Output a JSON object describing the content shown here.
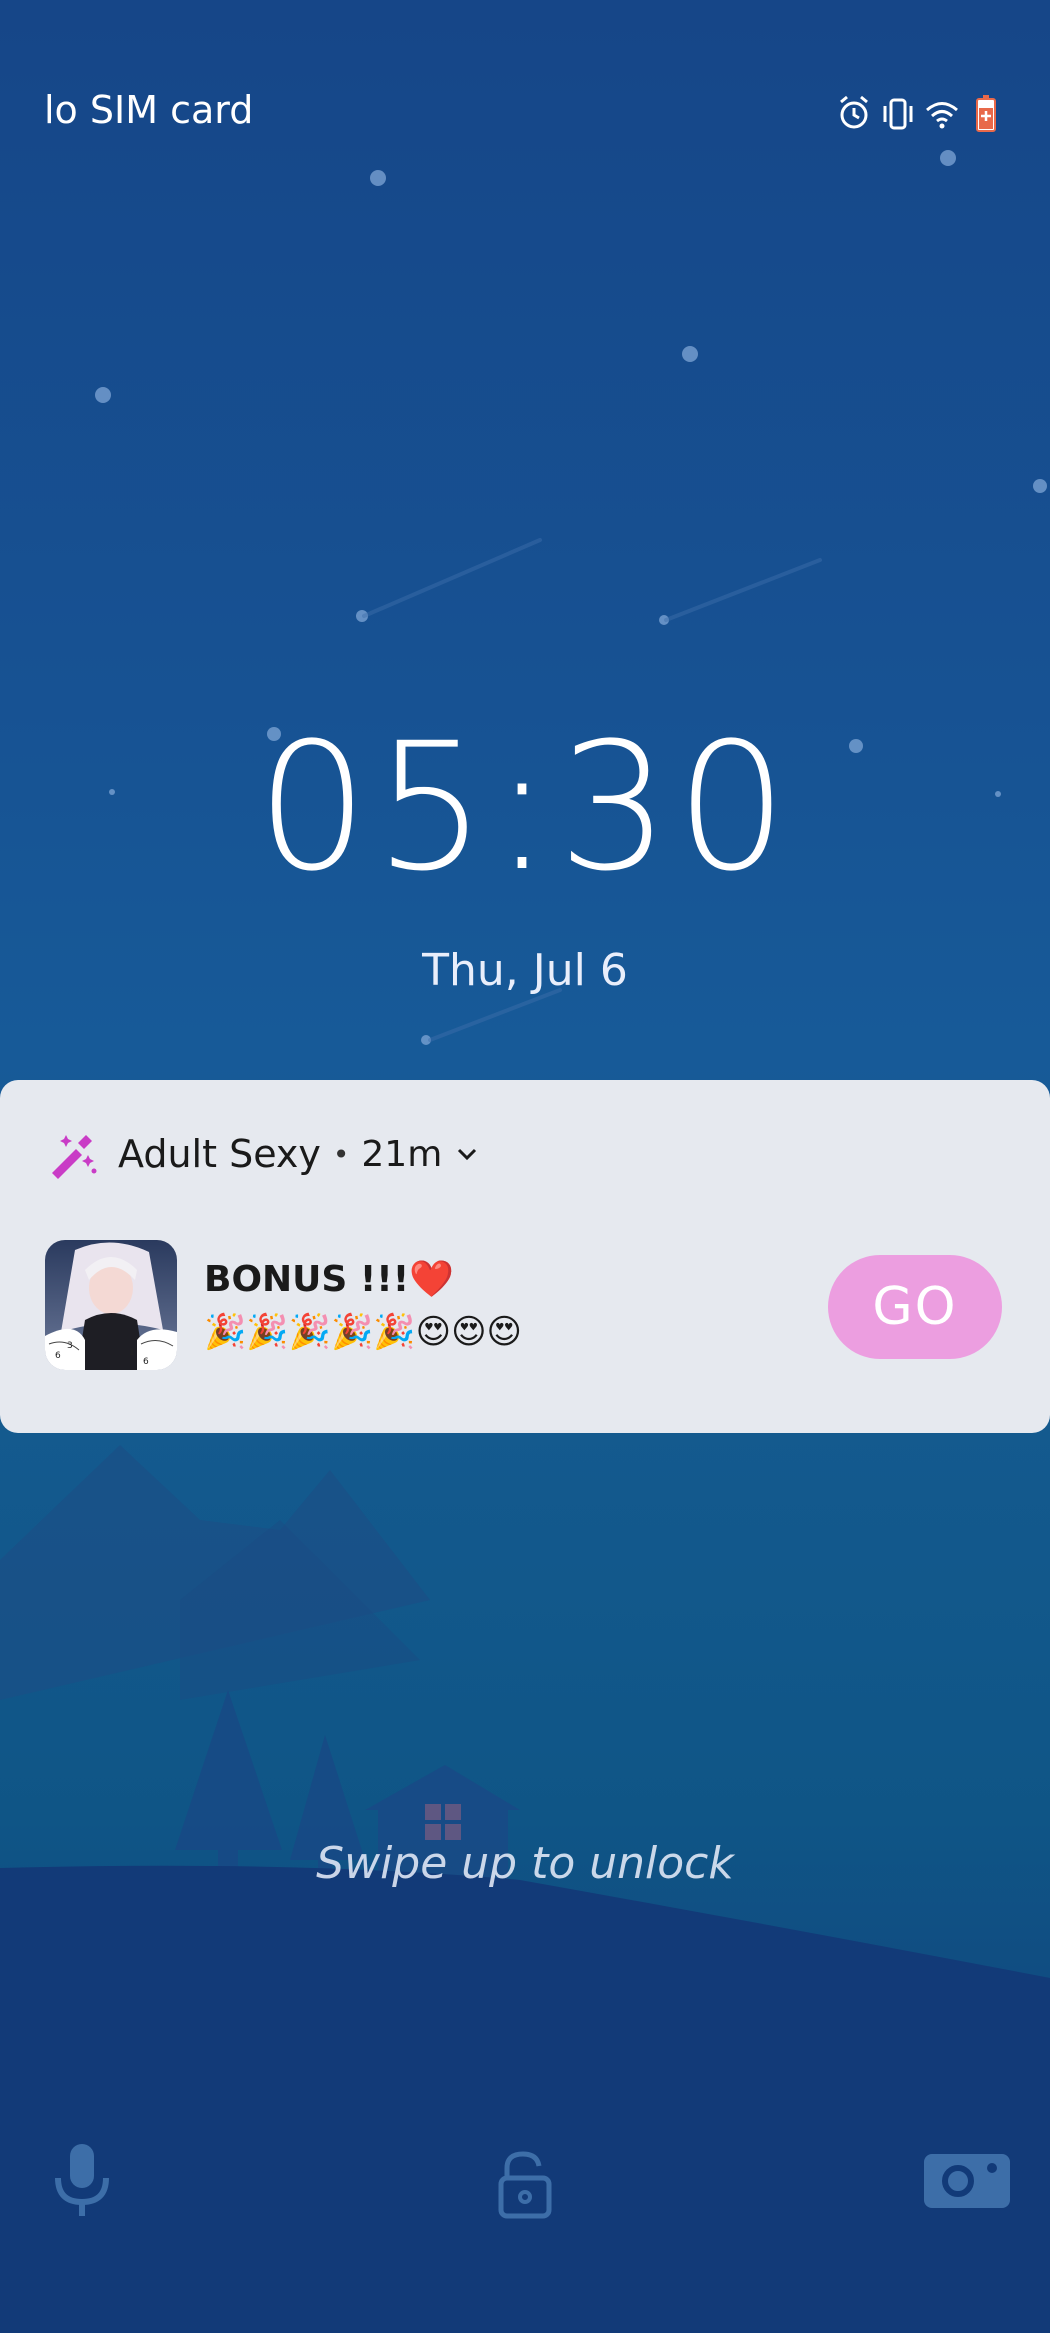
{
  "status_bar": {
    "carrier": "lo SIM card",
    "icons": [
      "alarm-icon",
      "vibrate-icon",
      "wifi-icon",
      "battery-charging-icon"
    ]
  },
  "lockscreen": {
    "time": "05:30",
    "date": "Thu, Jul 6"
  },
  "notification": {
    "app_icon": "magic-wand-icon",
    "app_name": "Adult Sexy",
    "separator": "•",
    "time_ago": "21m",
    "title": "BONUS !!!❤️",
    "body": "🎉🎉🎉🎉🎉😍😍😍",
    "action_label": "GO"
  },
  "swipe_hint": "Swipe up to unlock",
  "bottom_shortcuts": {
    "left": "microphone-icon",
    "center": "unlock-icon",
    "right": "camera-icon"
  },
  "colors": {
    "go_button": "#ec9ee0",
    "battery_charging": "#e8694a",
    "app_icon": "#c93cc6",
    "notification_bg": "#e6e9ef"
  }
}
